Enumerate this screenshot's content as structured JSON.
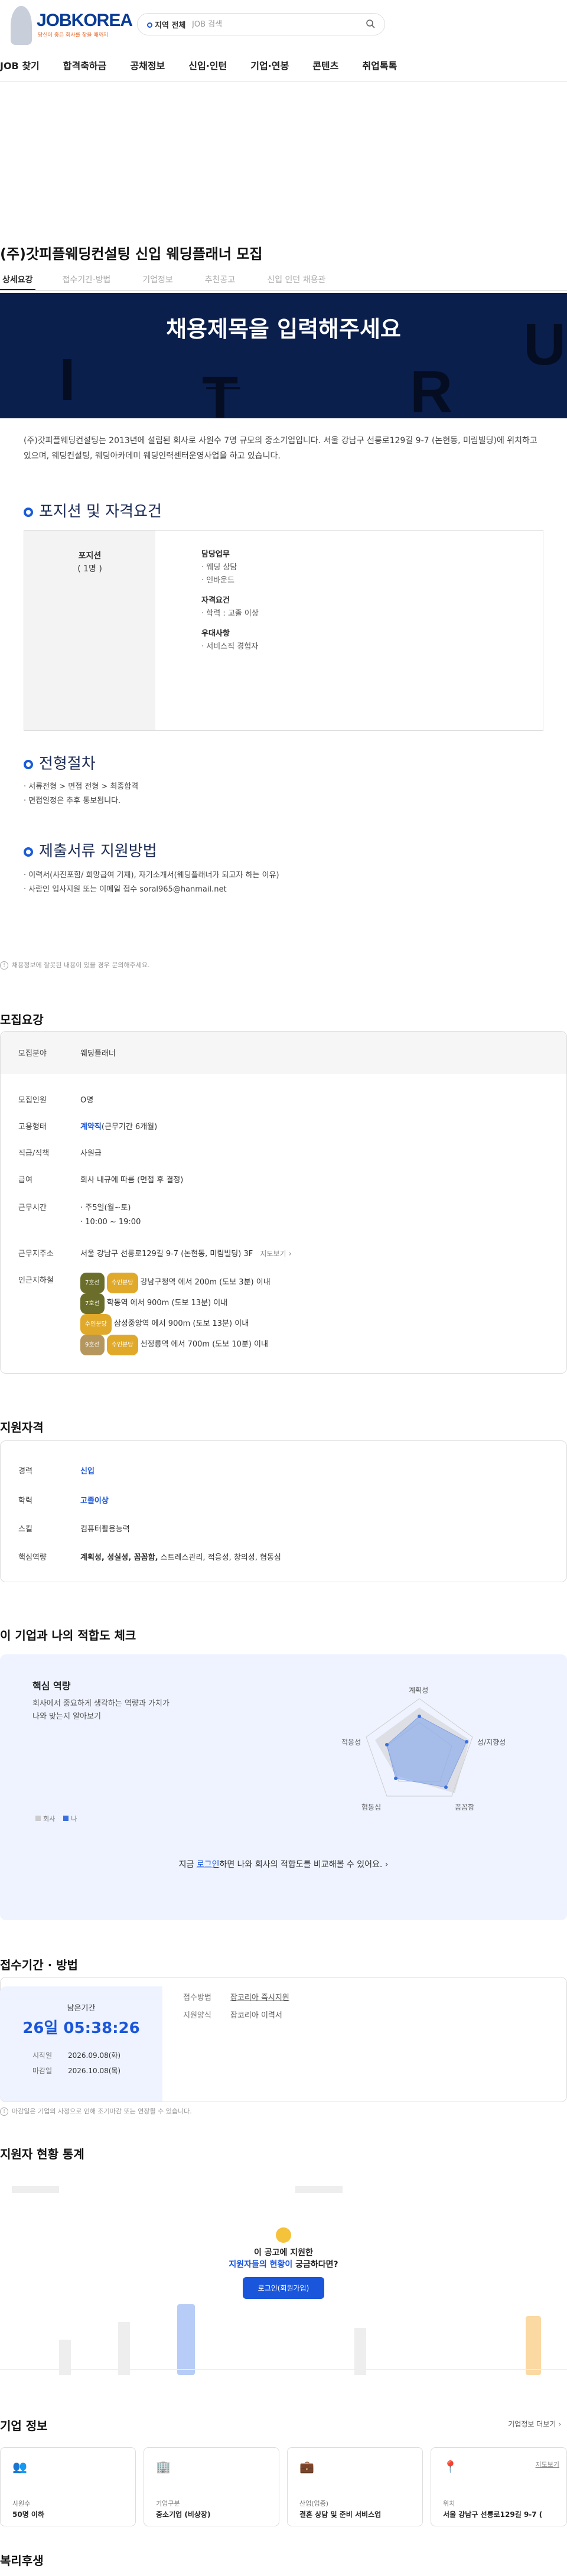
{
  "header": {
    "logo": "JOBKOREA",
    "logo_sub": "당신이 좋은 회사를 찾을 때까지",
    "region": "지역 전체",
    "search_placeholder": "JOB 검색"
  },
  "nav": [
    "JOB 찾기",
    "합격축하금",
    "공채정보",
    "신입·인턴",
    "기업·연봉",
    "콘텐츠",
    "취업톡톡"
  ],
  "job_title": "(주)갓피플웨딩컨설팅 신입 웨딩플래너 모집",
  "tabs": [
    "상세요강",
    "접수기간·방법",
    "기업정보",
    "추천공고",
    "신입 인턴 채용관"
  ],
  "banner": {
    "title": "채용제목을 입력해주세요",
    "deco": [
      "I",
      "T",
      "R",
      "U",
      "_"
    ]
  },
  "intro": "(주)갓피플웨딩컨설팅는 2013년에 설립된 회사로 사원수 7명 규모의 중소기업입니다. 서울 강남구 선릉로129길 9-7 (논현동, 미림빌딩)에 위치하고 있으며, 웨딩컨설팅, 웨딩아카데미 웨딩인력센터운영사업을 하고 있습니다.",
  "sec_position": {
    "title": "포지션 및 자격요건",
    "pos_label": "포지션",
    "pos_count": "( 1명 )",
    "duty_h": "담당업무",
    "duties": [
      "· 웨딩 상담",
      "· 인바운드"
    ],
    "req_h": "자격요건",
    "reqs": [
      "· 학력 : 고졸 이상"
    ],
    "pref_h": "우대사항",
    "prefs": [
      "· 서비스직 경험자"
    ]
  },
  "sec_process": {
    "title": "전형절차",
    "lines": [
      "· 서류전형 > 면접 전형 > 최종합격",
      "· 면접일정은 추후 통보됩니다."
    ]
  },
  "sec_docs": {
    "title": "제출서류 지원방법",
    "lines": [
      "· 이력서(사진포함/ 희망급여 기재), 자기소개서(웨딩플래너가 되고자 하는 이유)",
      "· 사람인 입사지원 또는 이메일 접수 soral965@hanmail.net"
    ]
  },
  "notice1": "채용정보에 잘못된 내용이 있을 경우 문의해주세요.",
  "summary": {
    "title": "모집요강",
    "rows": [
      {
        "k": "모집분야",
        "v": "웨딩플래너"
      },
      {
        "k": "모집인원",
        "v": "O명"
      },
      {
        "k": "고용형태",
        "v": "계약직",
        "v2": "(근무기간 6개월)"
      },
      {
        "k": "직급/직책",
        "v": "사원급"
      },
      {
        "k": "급여",
        "v": "회사 내규에 따름 (면접 후 결정)"
      },
      {
        "k": "근무시간",
        "v": "· 주5일(월~토)",
        "v2": "· 10:00 ~ 19:00"
      },
      {
        "k": "근무지주소",
        "v": "서울 강남구 선릉로129길 9-7 (논현동, 미림빌딩) 3F",
        "link": "지도보기"
      },
      {
        "k": "인근지하철",
        "v": ""
      }
    ],
    "subway": [
      {
        "line": "7호선",
        "line2": "수인분당",
        "text": "강남구청역 에서 200m (도보 3분) 이내",
        "c1": "#6b6e2a",
        "c2": "#e0a92a"
      },
      {
        "line": "7호선",
        "text": "학동역 에서 900m (도보 13분) 이내",
        "c1": "#6b6e2a"
      },
      {
        "line": "수인분당",
        "text": "삼성중앙역 에서 900m (도보 13분) 이내",
        "c1": "#e0a92a"
      },
      {
        "line": "9호선",
        "line2": "수인분당",
        "text": "선정릉역 에서 700m (도보 10분) 이내",
        "c1": "#b5965c",
        "c2": "#e0a92a"
      }
    ]
  },
  "qual": {
    "title": "지원자격",
    "rows": [
      {
        "k": "경력",
        "v": "신입"
      },
      {
        "k": "학력",
        "v": "고졸이상"
      },
      {
        "k": "스킬",
        "v": "컴퓨터활용능력"
      },
      {
        "k": "핵심역량",
        "vb": "계획성, 성실성, 꼼꼼함,",
        "v": " 스트레스관리, 적응성, 창의성, 협동심"
      }
    ]
  },
  "fit": {
    "title": "이 기업과 나의 적합도 체크",
    "card_h": "핵심 역량",
    "desc1": "회사에서 중요하게 생각하는 역량과 가치가",
    "desc2": "나와 맞는지 알아보기",
    "axes": [
      "계획성",
      "성/지향성",
      "꼼꼼함",
      "협동심",
      "적응성"
    ],
    "legend_a": "회사",
    "legend_b": "나",
    "cta_pre": "지금",
    "cta_link": "로그인",
    "cta_post": "하면 나와 회사의 적합도를 비교해볼 수 있어요."
  },
  "deadline": {
    "title": "접수기간 · 방법",
    "remain_l": "남은기간",
    "remain": "26일 05:38:26",
    "start_l": "시작일",
    "start": "2026.09.08(화)",
    "end_l": "마감일",
    "end": "2026.10.08(목)",
    "method_l": "접수방법",
    "method": "잡코리아 즉시지원",
    "form_l": "지원양식",
    "form": "잡코리아 이력서",
    "notice": "마감일은 기업의 사정으로 인해 조기마감 또는 연장될 수 있습니다."
  },
  "stats": {
    "title": "지원자 현황 통계",
    "q": "이 공고에 지원한",
    "q2": "지원자들의 현황이",
    "q3": "궁금하다면?",
    "btn": "로그인(회원가입)"
  },
  "company": {
    "title": "기업 정보",
    "more": "기업정보 더보기",
    "cards": [
      {
        "l": "사원수",
        "v": "50명 이하",
        "icon": "people-icon"
      },
      {
        "l": "기업구분",
        "v": "중소기업 (비상장)",
        "icon": "building-icon"
      },
      {
        "l": "산업(업종)",
        "v": "결혼 상담 및 준비 서비스업",
        "icon": "briefcase-icon"
      },
      {
        "l": "위치",
        "v": "서울 강남구 선릉로129길 9-7 (",
        "link": "지도보기",
        "icon": "pin-icon"
      }
    ]
  },
  "welfare": {
    "title": "복리후생"
  },
  "colors": {
    "brand": "#0a3c96",
    "accent": "#1a56db",
    "banner": "#0b1f4d"
  }
}
